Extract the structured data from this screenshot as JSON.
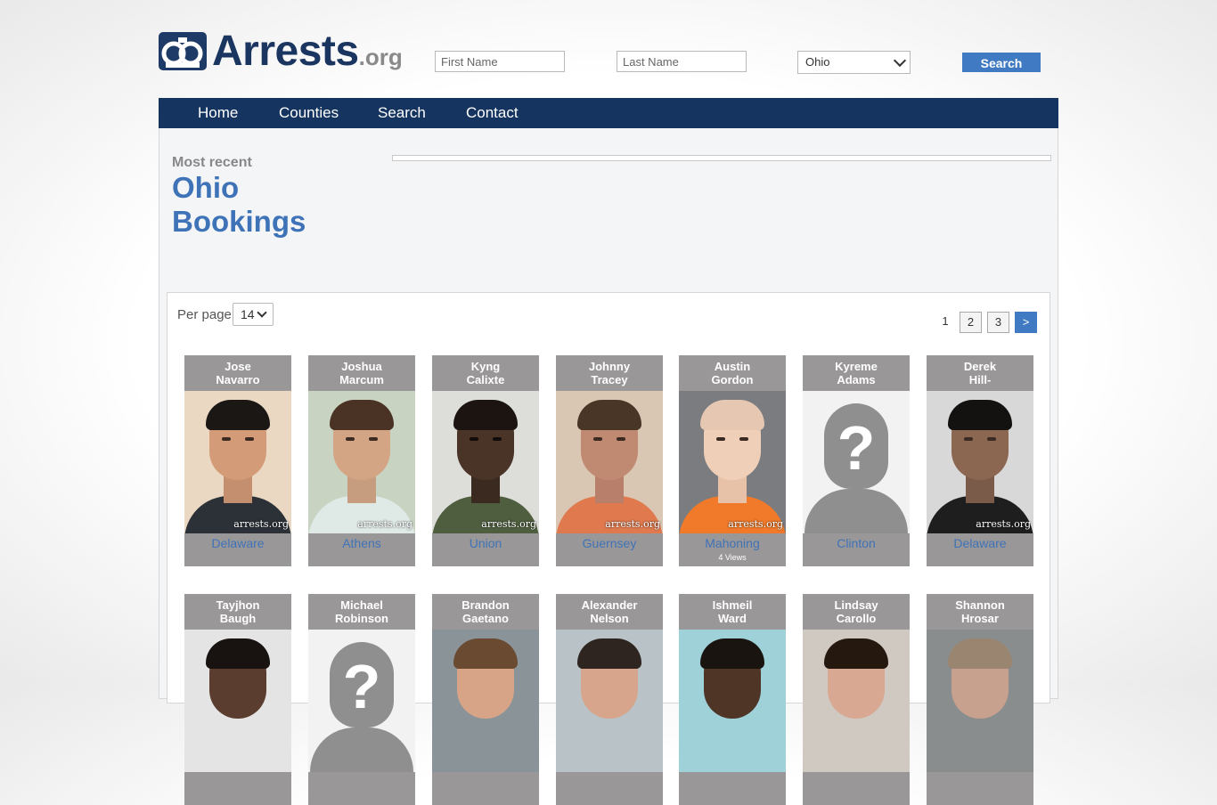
{
  "brand": {
    "name": "Arrests",
    "tld": ".org"
  },
  "search": {
    "first_placeholder": "First Name",
    "last_placeholder": "Last Name",
    "state": "Ohio",
    "button": "Search"
  },
  "nav": [
    "Home",
    "Counties",
    "Search",
    "Contact"
  ],
  "heading": {
    "kicker": "Most recent",
    "line1": "Ohio",
    "line2": "Bookings"
  },
  "perpage": {
    "label": "Per page",
    "value": "14"
  },
  "pagination": {
    "current": "1",
    "pages": [
      "2",
      "3"
    ],
    "next": ">"
  },
  "watermark": "arrests.org",
  "row1": [
    {
      "first": "Jose",
      "last": "Navarro",
      "county": "Delaware",
      "views": ""
    },
    {
      "first": "Joshua",
      "last": "Marcum",
      "county": "Athens",
      "views": ""
    },
    {
      "first": "Kyng",
      "last": "Calixte",
      "county": "Union",
      "views": ""
    },
    {
      "first": "Johnny",
      "last": "Tracey",
      "county": "Guernsey",
      "views": ""
    },
    {
      "first": "Austin",
      "last": "Gordon",
      "county": "Mahoning",
      "views": "4 Views"
    },
    {
      "first": "Kyreme",
      "last": "Adams",
      "county": "Clinton",
      "views": ""
    },
    {
      "first": "Derek",
      "last": "Hill-",
      "county": "Delaware",
      "views": ""
    }
  ],
  "row2": [
    {
      "first": "Tayjhon",
      "last": "Baugh"
    },
    {
      "first": "Michael",
      "last": "Robinson"
    },
    {
      "first": "Brandon",
      "last": "Gaetano"
    },
    {
      "first": "Alexander",
      "last": "Nelson"
    },
    {
      "first": "Ishmeil",
      "last": "Ward"
    },
    {
      "first": "Lindsay",
      "last": "Carollo"
    },
    {
      "first": "Shannon",
      "last": "Hrosar"
    }
  ],
  "colors": {
    "navy": "#153560",
    "link": "#3f73b7",
    "button": "#3f7ac2",
    "card": "#9a9799"
  }
}
